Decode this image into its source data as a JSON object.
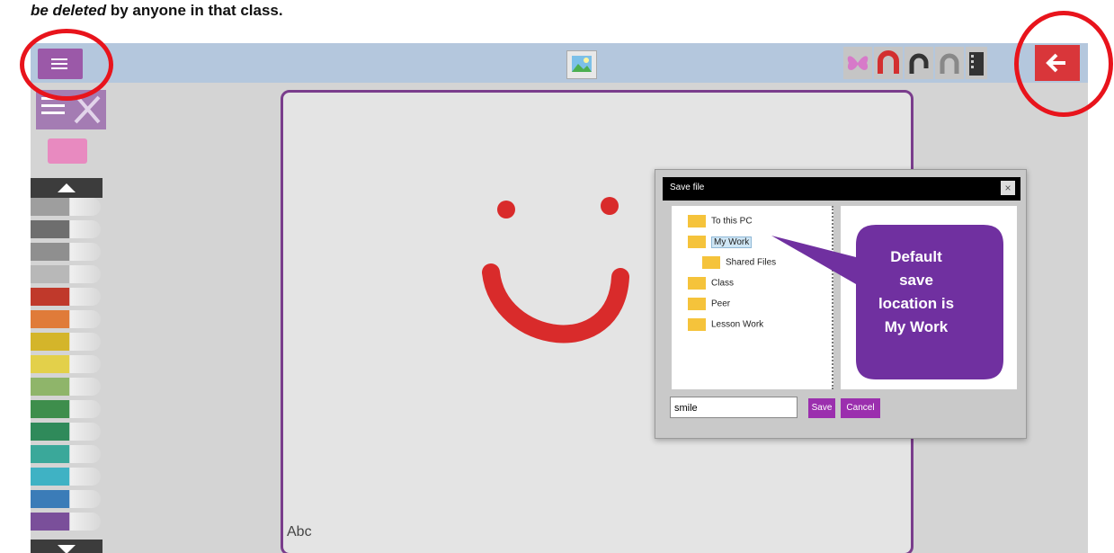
{
  "doc": {
    "intro_emphasis": "be deleted",
    "intro_rest": " by anyone in that class."
  },
  "canvas": {
    "label": "Abc"
  },
  "dialog": {
    "title": "Save file",
    "close_glyph": "×",
    "tree": [
      {
        "label": "To this PC",
        "selected": false
      },
      {
        "label": "My Work",
        "selected": true
      },
      {
        "label": "Shared Files",
        "selected": false
      },
      {
        "label": "Class",
        "selected": false
      },
      {
        "label": "Peer",
        "selected": false
      },
      {
        "label": "Lesson Work",
        "selected": false
      }
    ],
    "filename_value": "smile",
    "save_label": "Save",
    "cancel_label": "Cancel"
  },
  "callout": {
    "line1": "Default",
    "line2": "save",
    "line3": "location is",
    "line4": "My Work",
    "color": "#7030a0"
  },
  "pens": [
    {
      "color": "#9e9e9e"
    },
    {
      "color": "#6e6e6e"
    },
    {
      "color": "#8f8f8f"
    },
    {
      "color": "#b8b8b8"
    },
    {
      "color": "#c0392b"
    },
    {
      "color": "#e07b39"
    },
    {
      "color": "#d4b52a"
    },
    {
      "color": "#e3d04a"
    },
    {
      "color": "#8fb56a"
    },
    {
      "color": "#3e8e4c"
    },
    {
      "color": "#2f8a5a"
    },
    {
      "color": "#3aa89a"
    },
    {
      "color": "#3fb2c4"
    },
    {
      "color": "#3b7cb8"
    },
    {
      "color": "#7a4f9a"
    }
  ],
  "colors": {
    "accent": "#9b2fae",
    "annotation": "#e8141c",
    "smiley": "#d92b2b",
    "canvas_border": "#7a3d8c"
  }
}
